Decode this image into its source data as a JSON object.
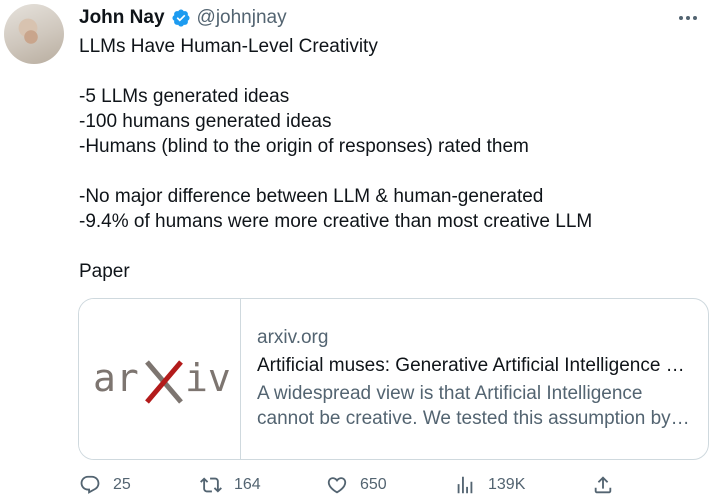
{
  "author": {
    "name": "John Nay",
    "handle": "@johnjnay",
    "verified": true
  },
  "tweet": {
    "lines": [
      "LLMs Have Human-Level Creativity",
      "",
      "-5 LLMs generated ideas",
      "-100 humans generated ideas",
      "-Humans (blind to the origin of responses) rated them",
      "",
      "-No major difference between LLM & human-generated",
      "-9.4% of humans were more creative than most creative LLM",
      "",
      "Paper"
    ]
  },
  "card": {
    "logo_text": "arXiv",
    "domain": "arxiv.org",
    "title": "Artificial muses: Generative Artificial Intelligence …",
    "description": "A widespread view is that Artificial Intelligence cannot be creative. We tested this assumption by…"
  },
  "actions": {
    "replies": "25",
    "retweets": "164",
    "likes": "650",
    "views": "139K"
  },
  "colors": {
    "text": "#0f1419",
    "secondary": "#536471",
    "verified": "#1d9bf0",
    "border": "#cfd9de",
    "arxiv_gray": "#7d7570",
    "arxiv_red": "#b31b1b"
  },
  "icons": [
    "verified-badge-icon",
    "more-options-icon",
    "reply-icon",
    "retweet-icon",
    "like-icon",
    "views-icon",
    "share-icon"
  ]
}
